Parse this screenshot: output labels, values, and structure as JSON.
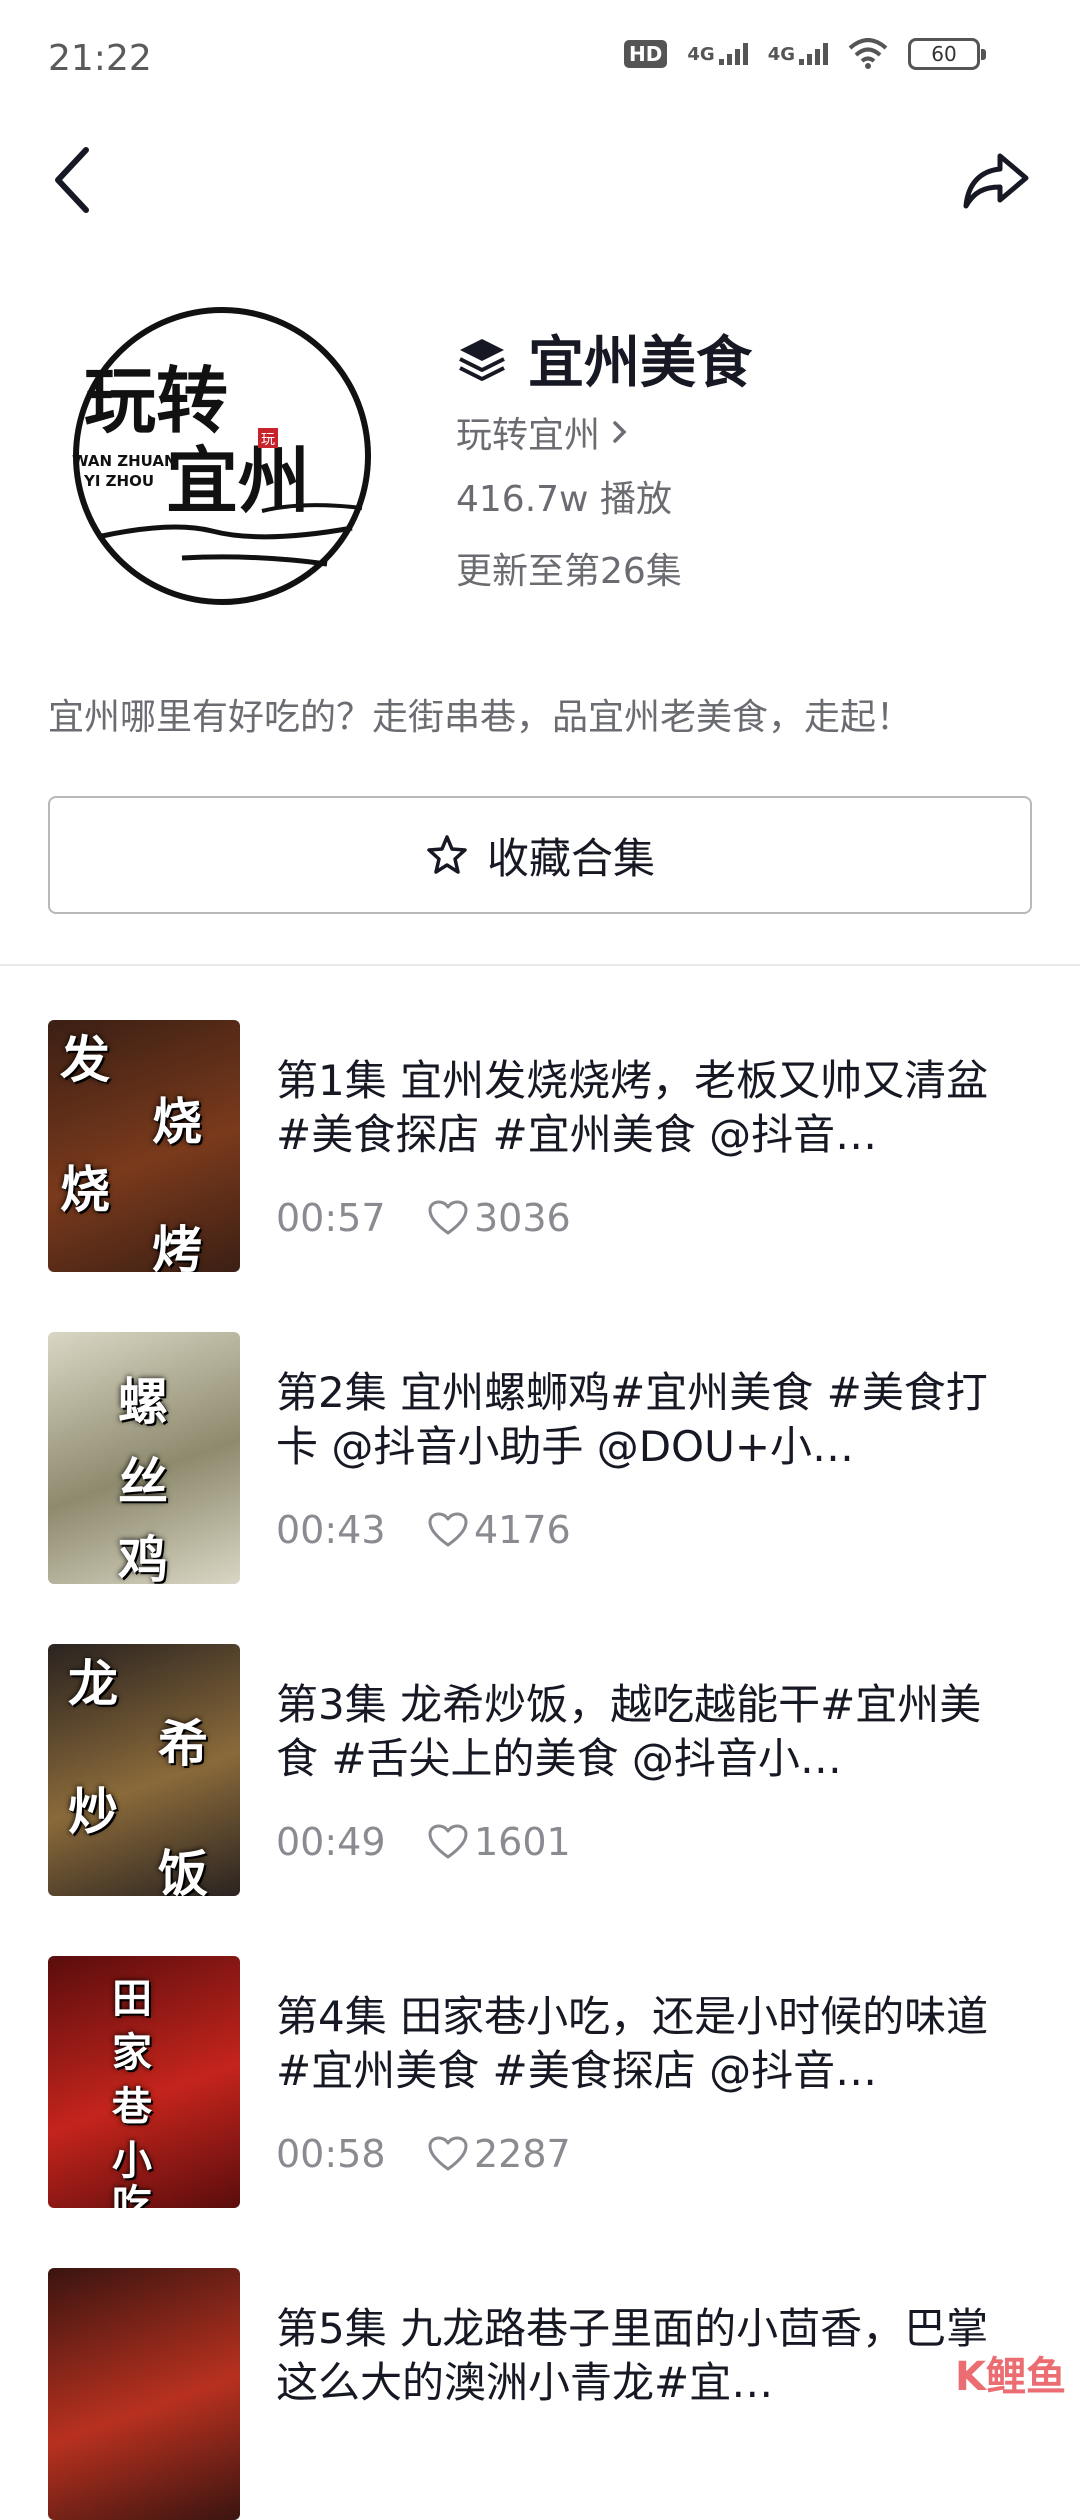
{
  "status_bar": {
    "time": "21:22",
    "hd": "HD",
    "net1": "4G",
    "net2": "4G",
    "battery": "60"
  },
  "header": {
    "cover_lines": [
      "玩转",
      "宜州"
    ],
    "cover_pinyin": [
      "WAN ZHUAN",
      "YI ZHOU"
    ],
    "cover_seal": "玩",
    "title": "宜州美食",
    "author": "玩转宜州",
    "plays": "416.7w 播放",
    "update": "更新至第26集",
    "description": "宜州哪里有好吃的？走街串巷，品宜州老美食，走起！",
    "collect_label": "收藏合集"
  },
  "episodes": [
    {
      "title": "第1集   宜州发烧烧烤，老板又帅又清盆#美食探店 #宜州美食 @抖音…",
      "duration": "00:57",
      "likes": "3036",
      "thumb_text": [
        "发",
        "烧",
        "烧",
        "烤"
      ],
      "thumb_colors": [
        "#3b1f14",
        "#7a3a1c"
      ]
    },
    {
      "title": "第2集   宜州螺蛳鸡#宜州美食 #美食打卡 @抖音小助手 @DOU+小…",
      "duration": "00:43",
      "likes": "4176",
      "thumb_text": [
        "螺",
        "丝",
        "鸡"
      ],
      "thumb_colors": [
        "#d9d6c4",
        "#8e8a6e"
      ]
    },
    {
      "title": "第3集   龙希炒饭，越吃越能干#宜州美食 #舌尖上的美食 @抖音小…",
      "duration": "00:49",
      "likes": "1601",
      "thumb_text": [
        "龙",
        "希",
        "炒",
        "饭"
      ],
      "thumb_colors": [
        "#2a2320",
        "#8a6a3a"
      ]
    },
    {
      "title": "第4集   田家巷小吃，还是小时候的味道#宜州美食 #美食探店 @抖音…",
      "duration": "00:58",
      "likes": "2287",
      "thumb_text": [
        "田",
        "家",
        "巷",
        "小",
        "吃"
      ],
      "thumb_colors": [
        "#5a0d0d",
        "#c4241c"
      ]
    },
    {
      "title": "第5集   九龙路巷子里面的小茴香，巴掌这么大的澳洲小青龙#宜…",
      "duration": "",
      "likes": "",
      "thumb_text": [],
      "thumb_colors": [
        "#3a1410",
        "#b8311f"
      ]
    }
  ],
  "watermark": "K鲤鱼"
}
